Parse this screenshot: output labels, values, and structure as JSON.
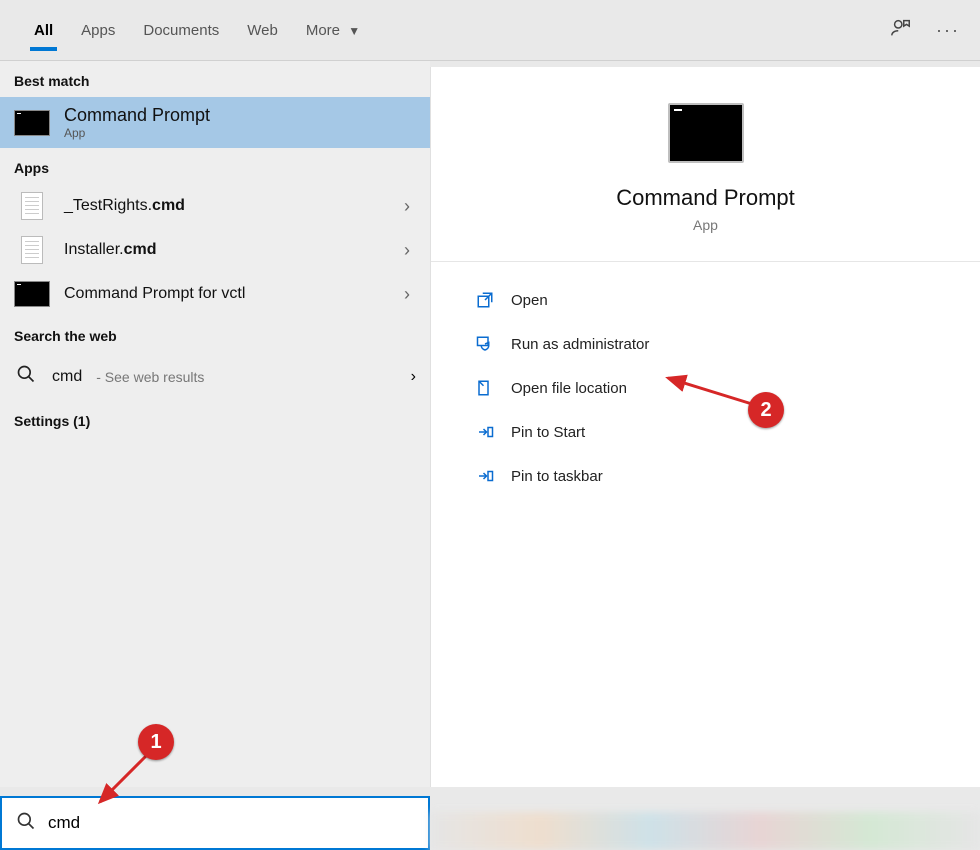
{
  "tabs": {
    "all": "All",
    "apps": "Apps",
    "documents": "Documents",
    "web": "Web",
    "more": "More"
  },
  "sections": {
    "best": "Best match",
    "apps": "Apps",
    "web": "Search the web",
    "settings": "Settings (1)"
  },
  "best": {
    "title": "Command Prompt",
    "sub": "App"
  },
  "appsList": [
    {
      "pre": "_TestRights.",
      "bold": "cmd"
    },
    {
      "pre": "Installer.",
      "bold": "cmd"
    },
    {
      "pre": "Command Prompt for vctl",
      "bold": ""
    }
  ],
  "webResult": {
    "query": "cmd",
    "hint": " - See web results"
  },
  "preview": {
    "title": "Command Prompt",
    "sub": "App"
  },
  "actions": {
    "open": "Open",
    "runAdmin": "Run as administrator",
    "openLoc": "Open file location",
    "pinStart": "Pin to Start",
    "pinTask": "Pin to taskbar"
  },
  "search": {
    "value": "cmd"
  },
  "annotations": {
    "one": "1",
    "two": "2"
  }
}
